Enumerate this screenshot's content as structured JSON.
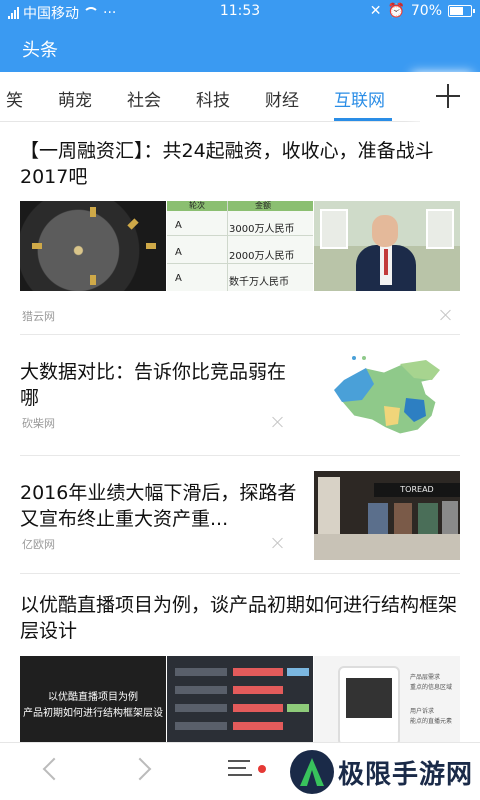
{
  "status_bar": {
    "carrier": "中国移动",
    "time": "11:53",
    "battery": "70%",
    "battery_level": 0.7,
    "icons": [
      "signal-icon",
      "wifi-icon",
      "more-icon",
      "mute-icon",
      "alarm-icon",
      "battery-icon"
    ]
  },
  "app_bar": {
    "title": "头条"
  },
  "tabs": [
    {
      "label": "笑"
    },
    {
      "label": "萌宠"
    },
    {
      "label": "社会"
    },
    {
      "label": "科技"
    },
    {
      "label": "财经"
    },
    {
      "label": "互联网",
      "active": true
    }
  ],
  "accent_color": "#2a8de6",
  "header_color": "#3a9af2",
  "articles": [
    {
      "title": "【一周融资汇】：共24起融资，收收心，准备战斗2017吧",
      "source": "猎云网",
      "table_thumb": {
        "headers": [
          "轮次",
          "金额"
        ],
        "rows": [
          [
            "A",
            "3000万人民币"
          ],
          [
            "A",
            "2000万人民币"
          ],
          [
            "A",
            "数千万人民币"
          ]
        ]
      }
    },
    {
      "title": "大数据对比：告诉你比竞品弱在哪",
      "source": "砍柴网"
    },
    {
      "title": "2016年业绩大幅下滑后，探路者又宣布终止重大资产重...",
      "source": "亿欧网",
      "store_sign": "TOREAD"
    },
    {
      "title": "以优酷直播项目为例，谈产品初期如何进行结构框架层设计",
      "slide_lines": [
        "以优酷直播项目为例",
        "产品初期如何进行结构框架层设"
      ],
      "phone_notes": [
        "产品层需求",
        "重点的信息区域",
        "用户诉求",
        "能点的直播元素"
      ]
    }
  ],
  "bottom_bar": {
    "icons": [
      "back-icon",
      "forward-icon",
      "menu-icon"
    ],
    "watermark": "极限手游网"
  }
}
